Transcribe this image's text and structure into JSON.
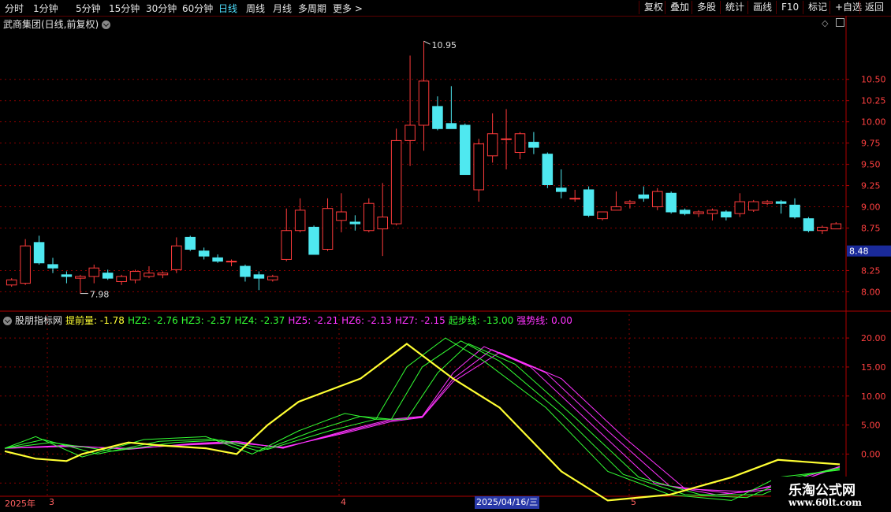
{
  "toolbar": {
    "periods": [
      "分时",
      "1分钟",
      "5分钟",
      "15分钟",
      "30分钟",
      "60分钟",
      "日线",
      "周线",
      "月线",
      "多周期",
      "更多"
    ],
    "active_period": "日线",
    "right_buttons": [
      "复权",
      "叠加",
      "多股",
      "统计",
      "画线",
      "F10",
      "标记",
      "+自选",
      "返回"
    ]
  },
  "stock": {
    "title": "武商集团(日线,前复权)"
  },
  "price_axis": {
    "ticks": [
      "10.50",
      "10.25",
      "10.00",
      "9.75",
      "9.50",
      "9.25",
      "9.00",
      "8.75",
      "8.25",
      "8.00"
    ],
    "current": "8.48"
  },
  "annotations": {
    "high": "10.95",
    "low": "7.98"
  },
  "indicator": {
    "name": "股朋指标网",
    "items": [
      {
        "label": "提前量: -1.78",
        "color": "#ffff33"
      },
      {
        "label": "HZ2: -2.76",
        "color": "#33ff33"
      },
      {
        "label": "HZ3: -2.57",
        "color": "#33ff33"
      },
      {
        "label": "HZ4: -2.37",
        "color": "#33ff33"
      },
      {
        "label": "HZ5: -2.21",
        "color": "#ff33ff"
      },
      {
        "label": "HZ6: -2.13",
        "color": "#ff33ff"
      },
      {
        "label": "HZ7: -2.15",
        "color": "#ff33ff"
      },
      {
        "label": "起步线: -13.00",
        "color": "#33ff33"
      },
      {
        "label": "强势线: 0.00",
        "color": "#ff33ff"
      }
    ],
    "ticks": [
      "20.00",
      "15.00",
      "10.00",
      "5.00",
      "0.00",
      "-5.00"
    ]
  },
  "time_axis": {
    "labels": [
      "2025年",
      "3",
      "4",
      "2025/04/16/三",
      "5"
    ]
  },
  "watermark": {
    "line1": "乐淘公式网",
    "line2": "www.60lt.com"
  },
  "colors": {
    "up": "#ff3b3b",
    "down": "#4fe8f0",
    "grid": "#8a0000",
    "lead": "#ffff33",
    "green": "#33ff33",
    "magenta": "#ff33ff"
  },
  "chart_data": [
    {
      "type": "candlestick",
      "title": "武商集团(日线,前复权)",
      "ylim": [
        7.8,
        11.1
      ],
      "candles": [
        {
          "o": 8.08,
          "h": 8.16,
          "l": 8.06,
          "c": 8.14
        },
        {
          "o": 8.1,
          "h": 8.62,
          "l": 8.08,
          "c": 8.54
        },
        {
          "o": 8.58,
          "h": 8.66,
          "l": 8.32,
          "c": 8.34
        },
        {
          "o": 8.32,
          "h": 8.4,
          "l": 8.22,
          "c": 8.28
        },
        {
          "o": 8.2,
          "h": 8.24,
          "l": 8.1,
          "c": 8.18
        },
        {
          "o": 8.16,
          "h": 8.2,
          "l": 7.98,
          "c": 8.18
        },
        {
          "o": 8.18,
          "h": 8.32,
          "l": 8.1,
          "c": 8.28
        },
        {
          "o": 8.22,
          "h": 8.26,
          "l": 8.14,
          "c": 8.16
        },
        {
          "o": 8.12,
          "h": 8.2,
          "l": 8.08,
          "c": 8.18
        },
        {
          "o": 8.14,
          "h": 8.26,
          "l": 8.1,
          "c": 8.24
        },
        {
          "o": 8.18,
          "h": 8.3,
          "l": 8.16,
          "c": 8.22
        },
        {
          "o": 8.2,
          "h": 8.24,
          "l": 8.16,
          "c": 8.22
        },
        {
          "o": 8.26,
          "h": 8.64,
          "l": 8.22,
          "c": 8.54
        },
        {
          "o": 8.64,
          "h": 8.66,
          "l": 8.48,
          "c": 8.5
        },
        {
          "o": 8.48,
          "h": 8.52,
          "l": 8.38,
          "c": 8.42
        },
        {
          "o": 8.4,
          "h": 8.44,
          "l": 8.34,
          "c": 8.36
        },
        {
          "o": 8.36,
          "h": 8.38,
          "l": 8.3,
          "c": 8.36
        },
        {
          "o": 8.3,
          "h": 8.32,
          "l": 8.12,
          "c": 8.18
        },
        {
          "o": 8.2,
          "h": 8.24,
          "l": 8.02,
          "c": 8.16
        },
        {
          "o": 8.14,
          "h": 8.2,
          "l": 8.12,
          "c": 8.18
        },
        {
          "o": 8.38,
          "h": 8.98,
          "l": 8.36,
          "c": 8.72
        },
        {
          "o": 8.72,
          "h": 9.1,
          "l": 8.7,
          "c": 8.96
        },
        {
          "o": 8.76,
          "h": 8.78,
          "l": 8.44,
          "c": 8.44
        },
        {
          "o": 8.5,
          "h": 9.1,
          "l": 8.48,
          "c": 8.98
        },
        {
          "o": 8.84,
          "h": 9.16,
          "l": 8.7,
          "c": 8.94
        },
        {
          "o": 8.82,
          "h": 8.9,
          "l": 8.72,
          "c": 8.8
        },
        {
          "o": 8.72,
          "h": 9.1,
          "l": 8.7,
          "c": 9.04
        },
        {
          "o": 8.74,
          "h": 9.28,
          "l": 8.42,
          "c": 8.88
        },
        {
          "o": 8.8,
          "h": 9.92,
          "l": 8.78,
          "c": 9.78
        },
        {
          "o": 9.78,
          "h": 10.78,
          "l": 9.48,
          "c": 9.96
        },
        {
          "o": 9.96,
          "h": 10.95,
          "l": 9.66,
          "c": 10.48
        },
        {
          "o": 10.18,
          "h": 10.3,
          "l": 9.9,
          "c": 9.92
        },
        {
          "o": 9.98,
          "h": 10.42,
          "l": 9.94,
          "c": 9.92
        },
        {
          "o": 9.96,
          "h": 9.98,
          "l": 9.38,
          "c": 9.38
        },
        {
          "o": 9.2,
          "h": 9.8,
          "l": 9.06,
          "c": 9.74
        },
        {
          "o": 9.6,
          "h": 10.1,
          "l": 9.52,
          "c": 9.86
        },
        {
          "o": 9.8,
          "h": 10.15,
          "l": 9.44,
          "c": 9.8
        },
        {
          "o": 9.64,
          "h": 9.88,
          "l": 9.56,
          "c": 9.86
        },
        {
          "o": 9.76,
          "h": 9.88,
          "l": 9.62,
          "c": 9.7
        },
        {
          "o": 9.62,
          "h": 9.64,
          "l": 9.22,
          "c": 9.26
        },
        {
          "o": 9.22,
          "h": 9.44,
          "l": 9.1,
          "c": 9.18
        },
        {
          "o": 9.1,
          "h": 9.2,
          "l": 9.06,
          "c": 9.1
        },
        {
          "o": 9.2,
          "h": 9.24,
          "l": 8.88,
          "c": 8.9
        },
        {
          "o": 8.86,
          "h": 8.94,
          "l": 8.84,
          "c": 8.94
        },
        {
          "o": 8.96,
          "h": 9.18,
          "l": 8.96,
          "c": 9.0
        },
        {
          "o": 9.04,
          "h": 9.08,
          "l": 8.98,
          "c": 9.06
        },
        {
          "o": 9.14,
          "h": 9.24,
          "l": 9.06,
          "c": 9.1
        },
        {
          "o": 9.0,
          "h": 9.22,
          "l": 8.96,
          "c": 9.18
        },
        {
          "o": 9.16,
          "h": 9.18,
          "l": 8.92,
          "c": 8.94
        },
        {
          "o": 8.96,
          "h": 8.98,
          "l": 8.9,
          "c": 8.92
        },
        {
          "o": 8.92,
          "h": 8.96,
          "l": 8.88,
          "c": 8.94
        },
        {
          "o": 8.92,
          "h": 8.98,
          "l": 8.84,
          "c": 8.96
        },
        {
          "o": 8.94,
          "h": 8.96,
          "l": 8.84,
          "c": 8.88
        },
        {
          "o": 8.92,
          "h": 9.16,
          "l": 8.88,
          "c": 9.06
        },
        {
          "o": 8.96,
          "h": 9.08,
          "l": 8.94,
          "c": 9.06
        },
        {
          "o": 9.04,
          "h": 9.08,
          "l": 9.02,
          "c": 9.06
        },
        {
          "o": 9.06,
          "h": 9.08,
          "l": 8.92,
          "c": 9.04
        },
        {
          "o": 9.02,
          "h": 9.1,
          "l": 8.86,
          "c": 8.88
        },
        {
          "o": 8.86,
          "h": 8.88,
          "l": 8.7,
          "c": 8.72
        },
        {
          "o": 8.72,
          "h": 8.78,
          "l": 8.68,
          "c": 8.76
        },
        {
          "o": 8.74,
          "h": 8.82,
          "l": 8.74,
          "c": 8.8
        }
      ]
    },
    {
      "type": "line",
      "title": "股朋指标网",
      "ylim": [
        -7,
        23
      ],
      "series": [
        {
          "name": "提前量",
          "color": "#ffff33",
          "points": [
            [
              0,
              0.5
            ],
            [
              4,
              -0.8
            ],
            [
              8,
              -1.2
            ],
            [
              10,
              0
            ],
            [
              16,
              2
            ],
            [
              20,
              1.5
            ],
            [
              26,
              1
            ],
            [
              30,
              0
            ],
            [
              34,
              5
            ],
            [
              38,
              9
            ],
            [
              42,
              11
            ],
            [
              46,
              13
            ],
            [
              52,
              19
            ],
            [
              58,
              13
            ],
            [
              64,
              8
            ],
            [
              72,
              -3
            ],
            [
              78,
              -8
            ],
            [
              86,
              -7
            ],
            [
              94,
              -4
            ],
            [
              100,
              -1
            ],
            [
              108,
              -1.78
            ]
          ]
        },
        {
          "name": "HZ2",
          "color": "#33ff33",
          "points": [
            [
              0,
              1
            ],
            [
              4,
              3
            ],
            [
              10,
              -0.5
            ],
            [
              18,
              2.5
            ],
            [
              26,
              3
            ],
            [
              32,
              0
            ],
            [
              38,
              4
            ],
            [
              44,
              7
            ],
            [
              48,
              6
            ],
            [
              52,
              15
            ],
            [
              57,
              20
            ],
            [
              62,
              16
            ],
            [
              70,
              8
            ],
            [
              78,
              -3
            ],
            [
              86,
              -7
            ],
            [
              94,
              -8
            ],
            [
              100,
              -4
            ],
            [
              108,
              -2.76
            ]
          ]
        },
        {
          "name": "HZ3",
          "color": "#33ff33",
          "points": [
            [
              0,
              1
            ],
            [
              5,
              2.5
            ],
            [
              12,
              0
            ],
            [
              20,
              2.2
            ],
            [
              27,
              2.6
            ],
            [
              33,
              0.5
            ],
            [
              40,
              4
            ],
            [
              46,
              6.5
            ],
            [
              50,
              6
            ],
            [
              54,
              15
            ],
            [
              59,
              19.5
            ],
            [
              64,
              16
            ],
            [
              72,
              7
            ],
            [
              80,
              -3.5
            ],
            [
              88,
              -7
            ],
            [
              96,
              -7.5
            ],
            [
              102,
              -4
            ],
            [
              108,
              -2.57
            ]
          ]
        },
        {
          "name": "HZ4",
          "color": "#33ff33",
          "points": [
            [
              0,
              1
            ],
            [
              6,
              2
            ],
            [
              14,
              0.5
            ],
            [
              22,
              2
            ],
            [
              28,
              2.4
            ],
            [
              34,
              0.8
            ],
            [
              42,
              4
            ],
            [
              48,
              6
            ],
            [
              52,
              6
            ],
            [
              56,
              14
            ],
            [
              60,
              19
            ],
            [
              66,
              15.5
            ],
            [
              74,
              6
            ],
            [
              82,
              -4
            ],
            [
              90,
              -7
            ],
            [
              98,
              -7
            ],
            [
              104,
              -3.5
            ],
            [
              108,
              -2.37
            ]
          ]
        },
        {
          "name": "HZ5",
          "color": "#ff33ff",
          "points": [
            [
              0,
              1
            ],
            [
              8,
              1.5
            ],
            [
              16,
              0.8
            ],
            [
              24,
              1.8
            ],
            [
              30,
              2.2
            ],
            [
              36,
              1
            ],
            [
              44,
              4
            ],
            [
              50,
              6
            ],
            [
              54,
              6.5
            ],
            [
              58,
              14
            ],
            [
              62,
              18.5
            ],
            [
              68,
              15
            ],
            [
              76,
              5
            ],
            [
              84,
              -5
            ],
            [
              92,
              -7
            ],
            [
              100,
              -6
            ],
            [
              108,
              -2.21
            ]
          ]
        },
        {
          "name": "HZ6",
          "color": "#ff33ff",
          "points": [
            [
              0,
              1
            ],
            [
              8,
              1.4
            ],
            [
              16,
              0.9
            ],
            [
              24,
              1.7
            ],
            [
              30,
              2
            ],
            [
              36,
              1.1
            ],
            [
              44,
              3.8
            ],
            [
              50,
              5.8
            ],
            [
              54,
              6.4
            ],
            [
              58,
              13
            ],
            [
              63,
              18
            ],
            [
              70,
              14
            ],
            [
              78,
              4
            ],
            [
              86,
              -5.5
            ],
            [
              94,
              -6.8
            ],
            [
              102,
              -5
            ],
            [
              108,
              -2.13
            ]
          ]
        },
        {
          "name": "HZ7",
          "color": "#ff33ff",
          "points": [
            [
              0,
              1
            ],
            [
              8,
              1.3
            ],
            [
              16,
              1
            ],
            [
              24,
              1.6
            ],
            [
              30,
              1.9
            ],
            [
              36,
              1.2
            ],
            [
              44,
              3.6
            ],
            [
              50,
              5.6
            ],
            [
              54,
              6.3
            ],
            [
              58,
              12.5
            ],
            [
              64,
              17.5
            ],
            [
              72,
              13
            ],
            [
              80,
              3
            ],
            [
              88,
              -6
            ],
            [
              96,
              -6.5
            ],
            [
              102,
              -4.5
            ],
            [
              108,
              -2.15
            ]
          ]
        }
      ]
    }
  ]
}
